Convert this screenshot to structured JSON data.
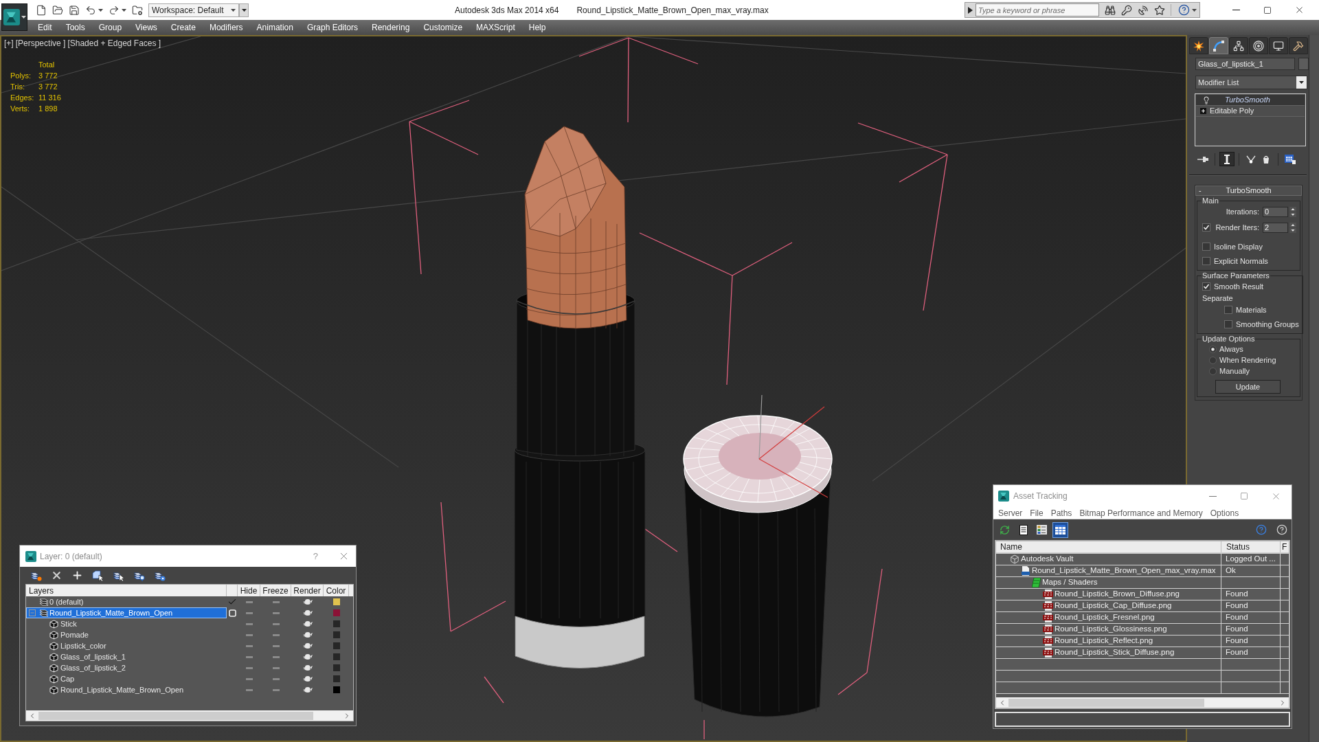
{
  "title_bar": {
    "workspace": "Workspace: Default",
    "app_title": "Autodesk 3ds Max 2014 x64",
    "file_name": "Round_Lipstick_Matte_Brown_Open_max_vray.max",
    "search": {
      "placeholder": "Type a keyword or phrase"
    }
  },
  "menu_bar": [
    "Edit",
    "Tools",
    "Group",
    "Views",
    "Create",
    "Modifiers",
    "Animation",
    "Graph Editors",
    "Rendering",
    "Customize",
    "MAXScript",
    "Help"
  ],
  "viewport": {
    "labels": [
      "[+]",
      "[Perspective ]",
      "[Shaded + Edged Faces ]"
    ],
    "stats": {
      "header": "Total",
      "rows": [
        {
          "label": "Polys:",
          "value": "3 772"
        },
        {
          "label": "Tris:",
          "value": "3 772"
        },
        {
          "label": "Edges:",
          "value": "11 316"
        },
        {
          "label": "Verts:",
          "value": "1 898"
        }
      ]
    }
  },
  "command_panel": {
    "tabs": [
      {
        "kind": "create",
        "selected": false
      },
      {
        "kind": "modify",
        "selected": true
      },
      {
        "kind": "hierarchy",
        "selected": false
      },
      {
        "kind": "motion",
        "selected": false
      },
      {
        "kind": "display",
        "selected": false
      },
      {
        "kind": "utilities",
        "selected": false
      }
    ],
    "object_name": "Glass_of_lipstick_1",
    "modifier_list": "Modifier List",
    "stack": [
      {
        "kind": "modifier",
        "name": "TurboSmooth",
        "selected": true
      },
      {
        "kind": "object",
        "name": "Editable Poly",
        "selected": false
      }
    ],
    "stack_tools": [
      {
        "kind": "pin",
        "on": false
      },
      {
        "kind": "end_result",
        "on": true
      },
      {
        "kind": "make_unique",
        "on": false
      },
      {
        "kind": "remove",
        "on": false
      },
      {
        "kind": "configure",
        "on": false
      }
    ],
    "rollout": {
      "sign": "-",
      "title": "TurboSmooth",
      "groups": [
        {
          "title": "Main",
          "controls": [
            {
              "kind": "spinner",
              "label": "Iterations:",
              "value": "0"
            },
            {
              "kind": "checked_spinner",
              "label": "Render Iters:",
              "value": "2",
              "checked": true
            },
            {
              "kind": "checkbox",
              "label": "Isoline Display",
              "checked": false
            },
            {
              "kind": "checkbox",
              "label": "Explicit Normals",
              "checked": false
            }
          ]
        },
        {
          "title": "Surface Parameters",
          "controls": [
            {
              "kind": "checkbox",
              "label": "Smooth Result",
              "checked": true
            },
            {
              "kind": "label",
              "label": "Separate",
              "children": [
                {
                  "kind": "checkbox",
                  "label": "Materials",
                  "checked": false
                },
                {
                  "kind": "checkbox",
                  "label": "Smoothing Groups",
                  "checked": false
                }
              ]
            }
          ]
        },
        {
          "title": "Update Options",
          "controls": [
            {
              "kind": "radio",
              "label": "Always",
              "selected": true
            },
            {
              "kind": "radio",
              "label": "When Rendering",
              "selected": false
            },
            {
              "kind": "radio",
              "label": "Manually",
              "selected": false
            },
            {
              "kind": "button",
              "label": "Update"
            }
          ]
        }
      ]
    }
  },
  "layer_manager": {
    "title": "Layer: 0 (default)",
    "help": "?",
    "columns": [
      "Layers",
      "Hide",
      "Freeze",
      "Render",
      "Color"
    ],
    "layers": [
      {
        "name": "0 (default)",
        "current": true,
        "selected": false,
        "color": "#e0c24e"
      },
      {
        "name": "Round_Lipstick_Matte_Brown_Open",
        "current": false,
        "selected": true,
        "expanded": true,
        "color": "#8b1236",
        "children": [
          {
            "name": "Stick",
            "color": "#262626"
          },
          {
            "name": "Pomade",
            "color": "#262626"
          },
          {
            "name": "Lipstick_color",
            "color": "#262626"
          },
          {
            "name": "Glass_of_lipstick_1",
            "color": "#262626"
          },
          {
            "name": "Glass_of_lipstick_2",
            "color": "#262626"
          },
          {
            "name": "Cap",
            "color": "#262626"
          },
          {
            "name": "Round_Lipstick_Matte_Brown_Open",
            "color": "#000000"
          }
        ]
      }
    ]
  },
  "asset_tracking": {
    "title": "Asset Tracking",
    "menu": [
      "Server",
      "File",
      "Paths",
      "Bitmap Performance and Memory",
      "Options"
    ],
    "toolbar": [
      {
        "kind": "refresh",
        "selected": false
      },
      {
        "kind": "list",
        "selected": false
      },
      {
        "kind": "thumbnails",
        "selected": false
      },
      {
        "kind": "table",
        "selected": true
      }
    ],
    "columns": [
      "Name",
      "Status",
      "F"
    ],
    "rows": [
      {
        "kind": "vault",
        "name": "Autodesk Vault",
        "status": "Logged Out ...",
        "children": [
          {
            "kind": "scene",
            "name": "Round_Lipstick_Matte_Brown_Open_max_vray.max",
            "status": "Ok",
            "children": [
              {
                "kind": "folder",
                "name": "Maps / Shaders",
                "children": [
                  {
                    "kind": "image",
                    "name": "Round_Lipstick_Brown_Diffuse.png",
                    "status": "Found"
                  },
                  {
                    "kind": "image",
                    "name": "Round_Lipstick_Cap_Diffuse.png",
                    "status": "Found"
                  },
                  {
                    "kind": "image",
                    "name": "Round_Lipstick_Fresnel.png",
                    "status": "Found"
                  },
                  {
                    "kind": "image",
                    "name": "Round_Lipstick_Glossiness.png",
                    "status": "Found"
                  },
                  {
                    "kind": "image",
                    "name": "Round_Lipstick_Reflect.png",
                    "status": "Found"
                  },
                  {
                    "kind": "image",
                    "name": "Round_Lipstick_Stick_Diffuse.png",
                    "status": "Found"
                  }
                ]
              }
            ]
          }
        ]
      }
    ]
  }
}
